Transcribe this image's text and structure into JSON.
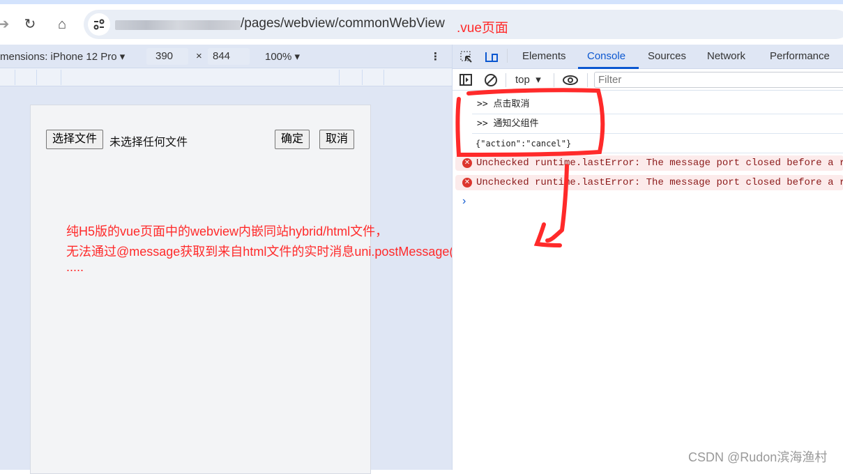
{
  "browser": {
    "url_visible_path": "/pages/webview/commonWebView",
    "annotation": ".vue页面"
  },
  "device_toolbar": {
    "dimensions_label": "mensions: iPhone 12 Pro",
    "width": "390",
    "times": "×",
    "height": "844",
    "zoom": "100%"
  },
  "page": {
    "choose_file_button": "选择文件",
    "no_file_text": "未选择任何文件",
    "confirm_button": "确定",
    "cancel_button": "取消"
  },
  "annotation_body": {
    "line1": "纯H5版的vue页面中的webview内嵌同站hybrid/html文件，",
    "line2": "无法通过@message获取到来自html文件的实时消息uni.postMessage({})",
    "line3": "....."
  },
  "devtools": {
    "tabs": [
      "Elements",
      "Console",
      "Sources",
      "Network",
      "Performance"
    ],
    "active_tab": "Console",
    "context": "top",
    "filter_placeholder": "Filter",
    "logs": [
      ">> 点击取消",
      ">> 通知父组件",
      "{\"action\":\"cancel\"}"
    ],
    "errors": [
      "Unchecked runtime.lastError: The message port closed before a resp",
      "Unchecked runtime.lastError: The message port closed before a resp"
    ]
  },
  "watermark": "CSDN @Rudon滨海渔村",
  "colors": {
    "annotation": "#ff2a2a",
    "accent": "#0b57d0"
  }
}
